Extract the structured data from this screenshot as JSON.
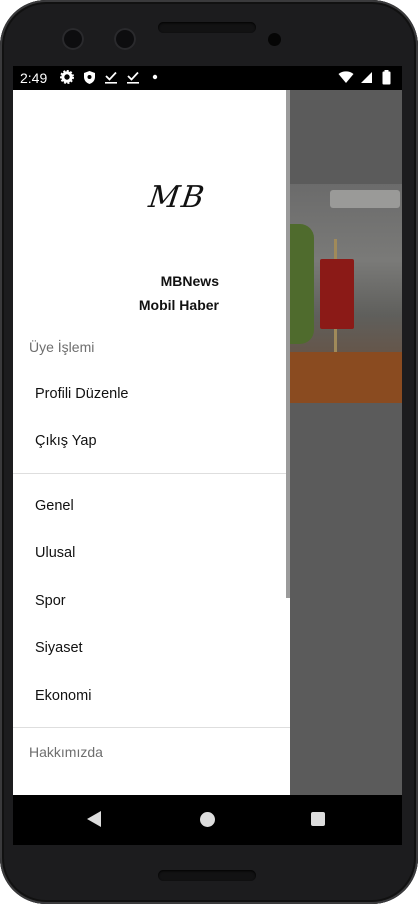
{
  "status_bar": {
    "time": "2:49",
    "left_icons": [
      "settings-icon",
      "shield-icon",
      "check-icon",
      "check-icon",
      "dot-icon"
    ],
    "right_icons": [
      "wifi-icon",
      "signal-icon",
      "battery-icon"
    ]
  },
  "drawer": {
    "logo_text": "MB",
    "app_name": "MBNews",
    "app_subtitle": "Mobil Haber",
    "sections": [
      {
        "title": "Üye İşlemi",
        "items": [
          "Profili Düzenle",
          "Çıkış Yap"
        ]
      },
      {
        "title": "",
        "items": [
          "Genel",
          "Ulusal",
          "Spor",
          "Siyaset",
          "Ekonomi"
        ]
      },
      {
        "title": "Hakkımızda",
        "items": []
      }
    ]
  },
  "nav": {
    "back": "back-icon",
    "home": "home-icon",
    "recents": "recents-icon"
  },
  "colors": {
    "drawer_bg": "#ffffff",
    "scrim": "#5b5b5b",
    "section_title": "#6e6e6e",
    "item_text": "#111111"
  }
}
